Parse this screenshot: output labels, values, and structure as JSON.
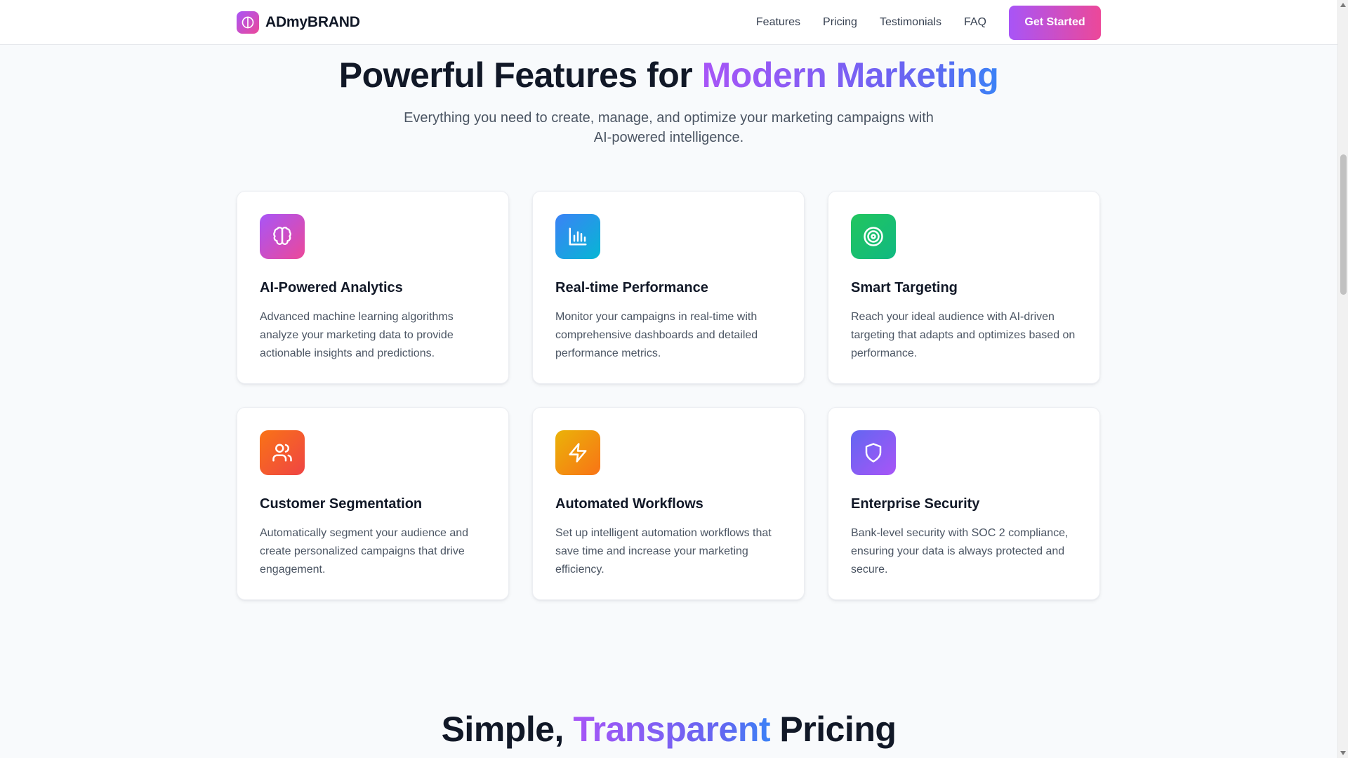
{
  "nav": {
    "brand": "ADmyBRAND",
    "links": [
      "Features",
      "Pricing",
      "Testimonials",
      "FAQ"
    ],
    "cta": "Get Started"
  },
  "features": {
    "title_prefix": "Powerful Features for ",
    "title_highlight": "Modern Marketing",
    "subtitle_line1": "Everything you need to create, manage, and optimize your marketing campaigns with",
    "subtitle_line2": "AI-powered intelligence.",
    "cards": [
      {
        "icon": "brain-icon",
        "color_from": "#a855f7",
        "color_to": "#ec4899",
        "title": "AI-Powered Analytics",
        "desc": "Advanced machine learning algorithms analyze your marketing data to provide actionable insights and predictions."
      },
      {
        "icon": "bar-chart-icon",
        "color_from": "#3b82f6",
        "color_to": "#06b6d4",
        "title": "Real-time Performance",
        "desc": "Monitor your campaigns in real-time with comprehensive dashboards and detailed performance metrics."
      },
      {
        "icon": "target-icon",
        "color_from": "#22c55e",
        "color_to": "#10b981",
        "title": "Smart Targeting",
        "desc": "Reach your ideal audience with AI-driven targeting that adapts and optimizes based on performance."
      },
      {
        "icon": "users-icon",
        "color_from": "#f97316",
        "color_to": "#ef4444",
        "title": "Customer Segmentation",
        "desc": "Automatically segment your audience and create personalized campaigns that drive engagement."
      },
      {
        "icon": "lightning-icon",
        "color_from": "#eab308",
        "color_to": "#f97316",
        "title": "Automated Workflows",
        "desc": "Set up intelligent automation workflows that save time and increase your marketing efficiency."
      },
      {
        "icon": "shield-icon",
        "color_from": "#6366f1",
        "color_to": "#a855f7",
        "title": "Enterprise Security",
        "desc": "Bank-level security with SOC 2 compliance, ensuring your data is always protected and secure."
      }
    ]
  },
  "pricing": {
    "title_prefix": "Simple, ",
    "title_highlight": "Transparent",
    "title_suffix": " Pricing"
  }
}
